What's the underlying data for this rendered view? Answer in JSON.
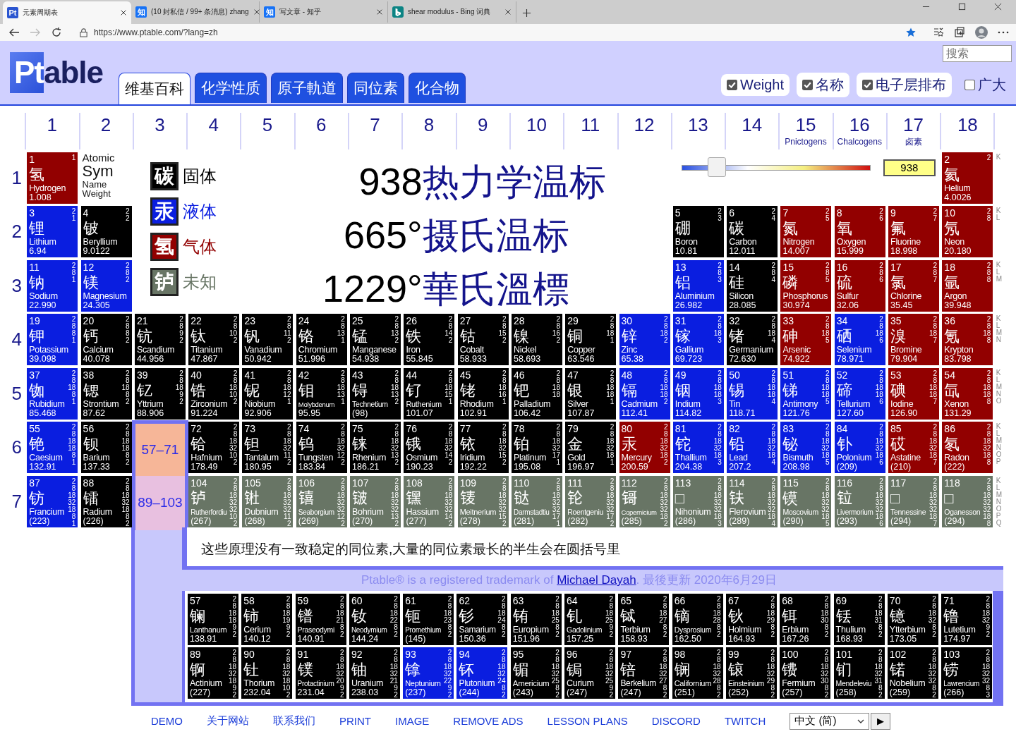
{
  "browser": {
    "tabs": [
      {
        "title": "元素周期表",
        "favicon": {
          "kind": "ptable",
          "text": "Pt"
        },
        "selected": true
      },
      {
        "title": "(10 封私信 / 99+ 条消息) zhang",
        "favicon": {
          "kind": "zhihu",
          "text": "知"
        },
        "selected": false
      },
      {
        "title": "写文章 - 知乎",
        "favicon": {
          "kind": "zhihu",
          "text": "知"
        },
        "selected": false
      },
      {
        "title": "shear modulus - Bing 词典",
        "favicon": {
          "kind": "bing"
        },
        "selected": false
      }
    ],
    "url": "https://www.ptable.com/?lang=zh"
  },
  "header": {
    "logo": {
      "boxed": "Pt",
      "rest": "able"
    },
    "tabs": [
      {
        "label": "维基百科",
        "selected": true
      },
      {
        "label": "化学性质",
        "selected": false
      },
      {
        "label": "原子軌道",
        "selected": false
      },
      {
        "label": "同位素",
        "selected": false
      },
      {
        "label": "化合物",
        "selected": false
      }
    ],
    "search": {
      "placeholder": "搜索"
    },
    "options": [
      {
        "label": "Weight",
        "checked": true
      },
      {
        "label": "名称",
        "checked": true
      },
      {
        "label": "电子层排布",
        "checked": true
      },
      {
        "label": "广大",
        "checked": false
      }
    ]
  },
  "groups": [
    {
      "number": "1"
    },
    {
      "number": "2"
    },
    {
      "number": "3"
    },
    {
      "number": "4"
    },
    {
      "number": "5"
    },
    {
      "number": "6"
    },
    {
      "number": "7"
    },
    {
      "number": "8"
    },
    {
      "number": "9"
    },
    {
      "number": "10"
    },
    {
      "number": "11"
    },
    {
      "number": "12"
    },
    {
      "number": "13"
    },
    {
      "number": "14"
    },
    {
      "number": "15",
      "subtitle": "Pnictogens"
    },
    {
      "number": "16",
      "subtitle": "Chalcogens"
    },
    {
      "number": "17",
      "subtitle": "卤素"
    },
    {
      "number": "18"
    }
  ],
  "key": {
    "atomic": "Atomic",
    "symbol": "Sym",
    "name": "Name",
    "weight": "Weight"
  },
  "legend": [
    {
      "symbol": "碳",
      "label": "固体",
      "color": "#000000"
    },
    {
      "symbol": "汞",
      "label": "液体",
      "color": "#0a1ee0"
    },
    {
      "symbol": "氢",
      "label": "气体",
      "color": "#920000"
    },
    {
      "symbol": "𬬻",
      "label": "未知",
      "color": "#687565"
    }
  ],
  "temperatures": [
    {
      "value": "938",
      "unit": "热力学温标"
    },
    {
      "value": "665°",
      "unit": "摄氏温标"
    },
    {
      "value": "1229°",
      "unit": "華氏溫標"
    }
  ],
  "slider": {
    "level": 0.16,
    "value": "938"
  },
  "periods": [
    {
      "label": "1",
      "shell_letters": "K",
      "cells": [
        {
          "kind": "element",
          "number": "1",
          "symbol": "氢",
          "name": "Hydrogen",
          "weight": "1.008",
          "shells": "1",
          "color": "#920000"
        },
        {
          "kind": "element",
          "number": "2",
          "symbol": "氦",
          "name": "Helium",
          "weight": "4.0026",
          "shells": "2",
          "color": "#920000"
        }
      ]
    },
    {
      "label": "2",
      "shell_letters": "K L",
      "cells": [
        {
          "kind": "element",
          "number": "3",
          "symbol": "锂",
          "name": "Lithium",
          "weight": "6.94",
          "shells": "2 1",
          "color": "#0a1ee0"
        },
        {
          "kind": "element",
          "number": "4",
          "symbol": "铍",
          "name": "Beryllium",
          "weight": "9.0122",
          "shells": "2 2",
          "color": "#000000"
        },
        {
          "kind": "element",
          "number": "5",
          "symbol": "硼",
          "name": "Boron",
          "weight": "10.81",
          "shells": "2 3",
          "color": "#000000"
        },
        {
          "kind": "element",
          "number": "6",
          "symbol": "碳",
          "name": "Carbon",
          "weight": "12.011",
          "shells": "2 4",
          "color": "#000000"
        },
        {
          "kind": "element",
          "number": "7",
          "symbol": "氮",
          "name": "Nitrogen",
          "weight": "14.007",
          "shells": "2 5",
          "color": "#920000"
        },
        {
          "kind": "element",
          "number": "8",
          "symbol": "氧",
          "name": "Oxygen",
          "weight": "15.999",
          "shells": "2 6",
          "color": "#920000"
        },
        {
          "kind": "element",
          "number": "9",
          "symbol": "氟",
          "name": "Fluorine",
          "weight": "18.998",
          "shells": "2 7",
          "color": "#920000"
        },
        {
          "kind": "element",
          "number": "10",
          "symbol": "氖",
          "name": "Neon",
          "weight": "20.180",
          "shells": "2 8",
          "color": "#920000"
        }
      ]
    },
    {
      "label": "3",
      "shell_letters": "K L M",
      "cells": [
        {
          "kind": "element",
          "number": "11",
          "symbol": "钠",
          "name": "Sodium",
          "weight": "22.990",
          "shells": "2 8 1",
          "color": "#0a1ee0"
        },
        {
          "kind": "element",
          "number": "12",
          "symbol": "镁",
          "name": "Magnesium",
          "weight": "24.305",
          "shells": "2 8 2",
          "color": "#0a1ee0"
        },
        {
          "kind": "element",
          "number": "13",
          "symbol": "铝",
          "name": "Aluminium",
          "weight": "26.982",
          "shells": "2 8 3",
          "color": "#0a1ee0"
        },
        {
          "kind": "element",
          "number": "14",
          "symbol": "硅",
          "name": "Silicon",
          "weight": "28.085",
          "shells": "2 8 4",
          "color": "#000000"
        },
        {
          "kind": "element",
          "number": "15",
          "symbol": "磷",
          "name": "Phosphorus",
          "weight": "30.974",
          "shells": "2 8 5",
          "color": "#920000"
        },
        {
          "kind": "element",
          "number": "16",
          "symbol": "硫",
          "name": "Sulfur",
          "weight": "32.06",
          "shells": "2 8 6",
          "color": "#920000"
        },
        {
          "kind": "element",
          "number": "17",
          "symbol": "氯",
          "name": "Chlorine",
          "weight": "35.45",
          "shells": "2 8 7",
          "color": "#920000"
        },
        {
          "kind": "element",
          "number": "18",
          "symbol": "氩",
          "name": "Argon",
          "weight": "39.948",
          "shells": "2 8 8",
          "color": "#920000"
        }
      ]
    },
    {
      "label": "4",
      "shell_letters": "K L M N",
      "cells": [
        {
          "kind": "element",
          "number": "19",
          "symbol": "钾",
          "name": "Potassium",
          "weight": "39.098",
          "shells": "2 8 8 1",
          "color": "#0a1ee0"
        },
        {
          "kind": "element",
          "number": "20",
          "symbol": "钙",
          "name": "Calcium",
          "weight": "40.078",
          "shells": "2 8 8 2",
          "color": "#000000"
        },
        {
          "kind": "element",
          "number": "21",
          "symbol": "钪",
          "name": "Scandium",
          "weight": "44.956",
          "shells": "2 8 9 2",
          "color": "#000000"
        },
        {
          "kind": "element",
          "number": "22",
          "symbol": "钛",
          "name": "Titanium",
          "weight": "47.867",
          "shells": "2 8 10 2",
          "color": "#000000"
        },
        {
          "kind": "element",
          "number": "23",
          "symbol": "钒",
          "name": "Vanadium",
          "weight": "50.942",
          "shells": "2 8 11 2",
          "color": "#000000"
        },
        {
          "kind": "element",
          "number": "24",
          "symbol": "铬",
          "name": "Chromium",
          "weight": "51.996",
          "shells": "2 8 13 1",
          "color": "#000000"
        },
        {
          "kind": "element",
          "number": "25",
          "symbol": "锰",
          "name": "Manganese",
          "weight": "54.938",
          "shells": "2 8 13 2",
          "color": "#000000"
        },
        {
          "kind": "element",
          "number": "26",
          "symbol": "铁",
          "name": "Iron",
          "weight": "55.845",
          "shells": "2 8 14 2",
          "color": "#000000"
        },
        {
          "kind": "element",
          "number": "27",
          "symbol": "钴",
          "name": "Cobalt",
          "weight": "58.933",
          "shells": "2 8 15 2",
          "color": "#000000"
        },
        {
          "kind": "element",
          "number": "28",
          "symbol": "镍",
          "name": "Nickel",
          "weight": "58.693",
          "shells": "2 8 16 2",
          "color": "#000000"
        },
        {
          "kind": "element",
          "number": "29",
          "symbol": "铜",
          "name": "Copper",
          "weight": "63.546",
          "shells": "2 8 18 1",
          "color": "#000000"
        },
        {
          "kind": "element",
          "number": "30",
          "symbol": "锌",
          "name": "Zinc",
          "weight": "65.38",
          "shells": "2 8 18 2",
          "color": "#0a1ee0"
        },
        {
          "kind": "element",
          "number": "31",
          "symbol": "镓",
          "name": "Gallium",
          "weight": "69.723",
          "shells": "2 8 18 3",
          "color": "#0a1ee0"
        },
        {
          "kind": "element",
          "number": "32",
          "symbol": "锗",
          "name": "Germanium",
          "weight": "72.630",
          "shells": "2 8 18 4",
          "color": "#000000"
        },
        {
          "kind": "element",
          "number": "33",
          "symbol": "砷",
          "name": "Arsenic",
          "weight": "74.922",
          "shells": "2 8 18 5",
          "color": "#920000"
        },
        {
          "kind": "element",
          "number": "34",
          "symbol": "硒",
          "name": "Selenium",
          "weight": "78.971",
          "shells": "2 8 18 6",
          "color": "#0a1ee0"
        },
        {
          "kind": "element",
          "number": "35",
          "symbol": "溴",
          "name": "Bromine",
          "weight": "79.904",
          "shells": "2 8 18 7",
          "color": "#920000"
        },
        {
          "kind": "element",
          "number": "36",
          "symbol": "氪",
          "name": "Krypton",
          "weight": "83.798",
          "shells": "2 8 18 8",
          "color": "#920000"
        }
      ]
    },
    {
      "label": "5",
      "shell_letters": "K L M N O",
      "cells": [
        {
          "kind": "element",
          "number": "37",
          "symbol": "铷",
          "name": "Rubidium",
          "weight": "85.468",
          "shells": "2 8 18 8 1",
          "color": "#0a1ee0"
        },
        {
          "kind": "element",
          "number": "38",
          "symbol": "锶",
          "name": "Strontium",
          "weight": "87.62",
          "shells": "2 8 18 8 2",
          "color": "#000000"
        },
        {
          "kind": "element",
          "number": "39",
          "symbol": "钇",
          "name": "Yttrium",
          "weight": "88.906",
          "shells": "2 8 18 9 2",
          "color": "#000000"
        },
        {
          "kind": "element",
          "number": "40",
          "symbol": "锆",
          "name": "Zirconium",
          "weight": "91.224",
          "shells": "2 8 18 10 2",
          "color": "#000000"
        },
        {
          "kind": "element",
          "number": "41",
          "symbol": "铌",
          "name": "Niobium",
          "weight": "92.906",
          "shells": "2 8 18 12 1",
          "color": "#000000"
        },
        {
          "kind": "element",
          "number": "42",
          "symbol": "钼",
          "name": "Molybdenum",
          "weight": "95.95",
          "shells": "2 8 18 13 1",
          "color": "#000000"
        },
        {
          "kind": "element",
          "number": "43",
          "symbol": "锝",
          "name": "Technetium",
          "weight": "(98)",
          "shells": "2 8 18 13 2",
          "color": "#000000"
        },
        {
          "kind": "element",
          "number": "44",
          "symbol": "钌",
          "name": "Ruthenium",
          "weight": "101.07",
          "shells": "2 8 18 15 1",
          "color": "#000000"
        },
        {
          "kind": "element",
          "number": "45",
          "symbol": "铑",
          "name": "Rhodium",
          "weight": "102.91",
          "shells": "2 8 18 16 1",
          "color": "#000000"
        },
        {
          "kind": "element",
          "number": "46",
          "symbol": "钯",
          "name": "Palladium",
          "weight": "106.42",
          "shells": "2 8 18 18",
          "color": "#000000"
        },
        {
          "kind": "element",
          "number": "47",
          "symbol": "银",
          "name": "Silver",
          "weight": "107.87",
          "shells": "2 8 18 18 1",
          "color": "#000000"
        },
        {
          "kind": "element",
          "number": "48",
          "symbol": "镉",
          "name": "Cadmium",
          "weight": "112.41",
          "shells": "2 8 18 18 2",
          "color": "#0a1ee0"
        },
        {
          "kind": "element",
          "number": "49",
          "symbol": "铟",
          "name": "Indium",
          "weight": "114.82",
          "shells": "2 8 18 18 3",
          "color": "#0a1ee0"
        },
        {
          "kind": "element",
          "number": "50",
          "symbol": "锡",
          "name": "Tin",
          "weight": "118.71",
          "shells": "2 8 18 18 4",
          "color": "#0a1ee0"
        },
        {
          "kind": "element",
          "number": "51",
          "symbol": "锑",
          "name": "Antimony",
          "weight": "121.76",
          "shells": "2 8 18 18 5",
          "color": "#0a1ee0"
        },
        {
          "kind": "element",
          "number": "52",
          "symbol": "碲",
          "name": "Tellurium",
          "weight": "127.60",
          "shells": "2 8 18 18 6",
          "color": "#0a1ee0"
        },
        {
          "kind": "element",
          "number": "53",
          "symbol": "碘",
          "name": "Iodine",
          "weight": "126.90",
          "shells": "2 8 18 18 7",
          "color": "#920000"
        },
        {
          "kind": "element",
          "number": "54",
          "symbol": "氙",
          "name": "Xenon",
          "weight": "131.29",
          "shells": "2 8 18 18 8",
          "color": "#920000"
        }
      ]
    },
    {
      "label": "6",
      "shell_letters": "K L M N O P",
      "cells": [
        {
          "kind": "element",
          "number": "55",
          "symbol": "铯",
          "name": "Caesium",
          "weight": "132.91",
          "shells": "2 8 18 18 8 1",
          "color": "#0a1ee0"
        },
        {
          "kind": "element",
          "number": "56",
          "symbol": "钡",
          "name": "Barium",
          "weight": "137.33",
          "shells": "2 8 18 18 8 2",
          "color": "#000000"
        },
        {
          "kind": "series",
          "range": "57–71",
          "color": "#f6b698"
        },
        {
          "kind": "element",
          "number": "72",
          "symbol": "铪",
          "name": "Hafnium",
          "weight": "178.49",
          "shells": "2 8 18 32 10 2",
          "color": "#000000"
        },
        {
          "kind": "element",
          "number": "73",
          "symbol": "钽",
          "name": "Tantalum",
          "weight": "180.95",
          "shells": "2 8 18 32 11 2",
          "color": "#000000"
        },
        {
          "kind": "element",
          "number": "74",
          "symbol": "钨",
          "name": "Tungsten",
          "weight": "183.84",
          "shells": "2 8 18 32 12 2",
          "color": "#000000"
        },
        {
          "kind": "element",
          "number": "75",
          "symbol": "铼",
          "name": "Rhenium",
          "weight": "186.21",
          "shells": "2 8 18 32 13 2",
          "color": "#000000"
        },
        {
          "kind": "element",
          "number": "76",
          "symbol": "锇",
          "name": "Osmium",
          "weight": "190.23",
          "shells": "2 8 18 32 14 2",
          "color": "#000000"
        },
        {
          "kind": "element",
          "number": "77",
          "symbol": "铱",
          "name": "Iridium",
          "weight": "192.22",
          "shells": "2 8 18 32 15 2",
          "color": "#000000"
        },
        {
          "kind": "element",
          "number": "78",
          "symbol": "铂",
          "name": "Platinum",
          "weight": "195.08",
          "shells": "2 8 18 32 17 1",
          "color": "#000000"
        },
        {
          "kind": "element",
          "number": "79",
          "symbol": "金",
          "name": "Gold",
          "weight": "196.97",
          "shells": "2 8 18 32 18 1",
          "color": "#000000"
        },
        {
          "kind": "element",
          "number": "80",
          "symbol": "汞",
          "name": "Mercury",
          "weight": "200.59",
          "shells": "2 8 18 32 18 2",
          "color": "#920000"
        },
        {
          "kind": "element",
          "number": "81",
          "symbol": "铊",
          "name": "Thallium",
          "weight": "204.38",
          "shells": "2 8 18 32 18 3",
          "color": "#0a1ee0"
        },
        {
          "kind": "element",
          "number": "82",
          "symbol": "铅",
          "name": "Lead",
          "weight": "207.2",
          "shells": "2 8 18 32 18 4",
          "color": "#0a1ee0"
        },
        {
          "kind": "element",
          "number": "83",
          "symbol": "铋",
          "name": "Bismuth",
          "weight": "208.98",
          "shells": "2 8 18 32 18 5",
          "color": "#0a1ee0"
        },
        {
          "kind": "element",
          "number": "84",
          "symbol": "钋",
          "name": "Polonium",
          "weight": "(209)",
          "shells": "2 8 18 32 18 6",
          "color": "#0a1ee0"
        },
        {
          "kind": "element",
          "number": "85",
          "symbol": "砹",
          "name": "Astatine",
          "weight": "(210)",
          "shells": "2 8 18 32 18 7",
          "color": "#920000"
        },
        {
          "kind": "element",
          "number": "86",
          "symbol": "氡",
          "name": "Radon",
          "weight": "(222)",
          "shells": "2 8 18 32 18 8",
          "color": "#920000"
        }
      ]
    },
    {
      "label": "7",
      "shell_letters": "K L M N O P Q",
      "cells": [
        {
          "kind": "element",
          "number": "87",
          "symbol": "钫",
          "name": "Francium",
          "weight": "(223)",
          "shells": "2 8 18 32 18 8 1",
          "color": "#0a1ee0"
        },
        {
          "kind": "element",
          "number": "88",
          "symbol": "镭",
          "name": "Radium",
          "weight": "(226)",
          "shells": "2 8 18 32 18 8 2",
          "color": "#000000"
        },
        {
          "kind": "series",
          "range": "89–103",
          "color": "#e8c0e0"
        },
        {
          "kind": "element",
          "number": "104",
          "symbol": "𬬻",
          "name": "Rutherfordiu",
          "weight": "(267)",
          "shells": "2 8 18 32 32 10 2",
          "color": "#687565"
        },
        {
          "kind": "element",
          "number": "105",
          "symbol": "𬭊",
          "name": "Dubnium",
          "weight": "(268)",
          "shells": "2 8 18 32 32 11 2",
          "color": "#687565"
        },
        {
          "kind": "element",
          "number": "106",
          "symbol": "𬭳",
          "name": "Seaborgium",
          "weight": "(269)",
          "shells": "2 8 18 32 32 12 2",
          "color": "#687565"
        },
        {
          "kind": "element",
          "number": "107",
          "symbol": "𬭛",
          "name": "Bohrium",
          "weight": "(270)",
          "shells": "2 8 18 32 32 13 2",
          "color": "#687565"
        },
        {
          "kind": "element",
          "number": "108",
          "symbol": "𬭶",
          "name": "Hassium",
          "weight": "(277)",
          "shells": "2 8 18 32 32 14 2",
          "color": "#687565"
        },
        {
          "kind": "element",
          "number": "109",
          "symbol": "鿏",
          "name": "Meitnerium",
          "weight": "(278)",
          "shells": "2 8 18 32 32 15 2",
          "color": "#687565"
        },
        {
          "kind": "element",
          "number": "110",
          "symbol": "𫟼",
          "name": "Darmstadtiu",
          "weight": "(281)",
          "shells": "2 8 18 32 32 17 1",
          "color": "#687565"
        },
        {
          "kind": "element",
          "number": "111",
          "symbol": "𬬭",
          "name": "Roentgeniu",
          "weight": "(282)",
          "shells": "2 8 18 32 32 17 2",
          "color": "#687565"
        },
        {
          "kind": "element",
          "number": "112",
          "symbol": "鿔",
          "name": "Copernicium",
          "weight": "(285)",
          "shells": "2 8 18 32 32 18 2",
          "color": "#687565"
        },
        {
          "kind": "element",
          "number": "113",
          "symbol": "□",
          "name": "Nihonium",
          "weight": "(286)",
          "shells": "2 8 18 32 32 18 3",
          "color": "#687565"
        },
        {
          "kind": "element",
          "number": "114",
          "symbol": "𫓧",
          "name": "Flerovium",
          "weight": "(289)",
          "shells": "2 8 18 32 32 18 4",
          "color": "#687565"
        },
        {
          "kind": "element",
          "number": "115",
          "symbol": "镆",
          "name": "Moscovium",
          "weight": "(290)",
          "shells": "2 8 18 32 32 18 5",
          "color": "#687565"
        },
        {
          "kind": "element",
          "number": "116",
          "symbol": "𫟷",
          "name": "Livermorium",
          "weight": "(293)",
          "shells": "2 8 18 32 32 18 6",
          "color": "#687565"
        },
        {
          "kind": "element",
          "number": "117",
          "symbol": "□",
          "name": "Tennessine",
          "weight": "(294)",
          "shells": "2 8 18 32 32 18 7",
          "color": "#687565"
        },
        {
          "kind": "element",
          "number": "118",
          "symbol": "□",
          "name": "Oganesson",
          "weight": "(294)",
          "shells": "2 8 18 32 32 18 8",
          "color": "#687565"
        }
      ]
    }
  ],
  "note": "这些原理没有一致稳定的同位素,大量的同位素最长的半生会在圆括号里",
  "trademark": {
    "before": "Ptable® is a registered trademark of ",
    "link": "Michael Dayah",
    "after": ". 最後更新 2020年6月29日"
  },
  "f_block": [
    {
      "cells": [
        {
          "number": "57",
          "symbol": "镧",
          "name": "Lanthanum",
          "weight": "138.91",
          "shells": "2 8 18 18 9 2",
          "color": "#000000"
        },
        {
          "number": "58",
          "symbol": "铈",
          "name": "Cerium",
          "weight": "140.12",
          "shells": "2 8 18 19 9 2",
          "color": "#000000"
        },
        {
          "number": "59",
          "symbol": "镨",
          "name": "Praseodymi",
          "weight": "140.91",
          "shells": "2 8 18 21 8 2",
          "color": "#000000"
        },
        {
          "number": "60",
          "symbol": "钕",
          "name": "Neodymium",
          "weight": "144.24",
          "shells": "2 8 18 22 8 2",
          "color": "#000000"
        },
        {
          "number": "61",
          "symbol": "钷",
          "name": "Promethium",
          "weight": "(145)",
          "shells": "2 8 18 23 8 2",
          "color": "#000000"
        },
        {
          "number": "62",
          "symbol": "钐",
          "name": "Samarium",
          "weight": "150.36",
          "shells": "2 8 18 24 8 2",
          "color": "#000000"
        },
        {
          "number": "63",
          "symbol": "铕",
          "name": "Europium",
          "weight": "151.96",
          "shells": "2 8 18 25 8 2",
          "color": "#000000"
        },
        {
          "number": "64",
          "symbol": "钆",
          "name": "Gadolinium",
          "weight": "157.25",
          "shells": "2 8 18 25 9 2",
          "color": "#000000"
        },
        {
          "number": "65",
          "symbol": "铽",
          "name": "Terbium",
          "weight": "158.93",
          "shells": "2 8 18 27 8 2",
          "color": "#000000"
        },
        {
          "number": "66",
          "symbol": "镝",
          "name": "Dysprosium",
          "weight": "162.50",
          "shells": "2 8 18 28 8 2",
          "color": "#000000"
        },
        {
          "number": "67",
          "symbol": "钬",
          "name": "Holmium",
          "weight": "164.93",
          "shells": "2 8 18 29 8 2",
          "color": "#000000"
        },
        {
          "number": "68",
          "symbol": "铒",
          "name": "Erbium",
          "weight": "167.26",
          "shells": "2 8 18 30 8 2",
          "color": "#000000"
        },
        {
          "number": "69",
          "symbol": "铥",
          "name": "Thulium",
          "weight": "168.93",
          "shells": "2 8 18 31 8 2",
          "color": "#000000"
        },
        {
          "number": "70",
          "symbol": "镱",
          "name": "Ytterbium",
          "weight": "173.05",
          "shells": "2 8 18 32 8 2",
          "color": "#000000"
        },
        {
          "number": "71",
          "symbol": "镥",
          "name": "Lutetium",
          "weight": "174.97",
          "shells": "2 8 18 32 9 2",
          "color": "#000000"
        }
      ]
    },
    {
      "cells": [
        {
          "number": "89",
          "symbol": "锕",
          "name": "Actinium",
          "weight": "(227)",
          "shells": "2 8 18 32 18 9 2",
          "color": "#000000"
        },
        {
          "number": "90",
          "symbol": "钍",
          "name": "Thorium",
          "weight": "232.04",
          "shells": "2 8 18 32 18 10 2",
          "color": "#000000"
        },
        {
          "number": "91",
          "symbol": "镤",
          "name": "Protactinium",
          "weight": "231.04",
          "shells": "2 8 18 32 20 9 2",
          "color": "#000000"
        },
        {
          "number": "92",
          "symbol": "铀",
          "name": "Uranium",
          "weight": "238.03",
          "shells": "2 8 18 32 21 9 2",
          "color": "#000000"
        },
        {
          "number": "93",
          "symbol": "镎",
          "name": "Neptunium",
          "weight": "(237)",
          "shells": "2 8 18 32 22 9 2",
          "color": "#0a1ee0"
        },
        {
          "number": "94",
          "symbol": "钚",
          "name": "Plutonium",
          "weight": "(244)",
          "shells": "2 8 18 32 24 8 2",
          "color": "#0a1ee0"
        },
        {
          "number": "95",
          "symbol": "镅",
          "name": "Americium",
          "weight": "(243)",
          "shells": "2 8 18 32 25 8 2",
          "color": "#000000"
        },
        {
          "number": "96",
          "symbol": "锔",
          "name": "Curium",
          "weight": "(247)",
          "shells": "2 8 18 32 25 9 2",
          "color": "#000000"
        },
        {
          "number": "97",
          "symbol": "锫",
          "name": "Berkelium",
          "weight": "(247)",
          "shells": "2 8 18 32 27 8 2",
          "color": "#000000"
        },
        {
          "number": "98",
          "symbol": "锎",
          "name": "Californium",
          "weight": "(251)",
          "shells": "2 8 18 32 28 8 2",
          "color": "#000000"
        },
        {
          "number": "99",
          "symbol": "锿",
          "name": "Einsteinium",
          "weight": "(252)",
          "shells": "2 8 18 32 29 8 2",
          "color": "#000000"
        },
        {
          "number": "100",
          "symbol": "镄",
          "name": "Fermium",
          "weight": "(257)",
          "shells": "2 8 18 32 30 8 2",
          "color": "#000000"
        },
        {
          "number": "101",
          "symbol": "钔",
          "name": "Mendeleviu",
          "weight": "(258)",
          "shells": "2 8 18 32 31 8 2",
          "color": "#000000"
        },
        {
          "number": "102",
          "symbol": "锘",
          "name": "Nobelium",
          "weight": "(259)",
          "shells": "2 8 18 32 32 8 2",
          "color": "#000000"
        },
        {
          "number": "103",
          "symbol": "铹",
          "name": "Lawrencium",
          "weight": "(266)",
          "shells": "2 8 18 32 32 8 3",
          "color": "#000000"
        }
      ]
    }
  ],
  "footer": {
    "links": [
      "DEMO",
      "关于网站",
      "联系我们",
      "PRINT",
      "IMAGE",
      "REMOVE ADS",
      "LESSON PLANS",
      "DISCORD",
      "TWITCH"
    ],
    "language": "中文 (简)",
    "go": "▶"
  }
}
